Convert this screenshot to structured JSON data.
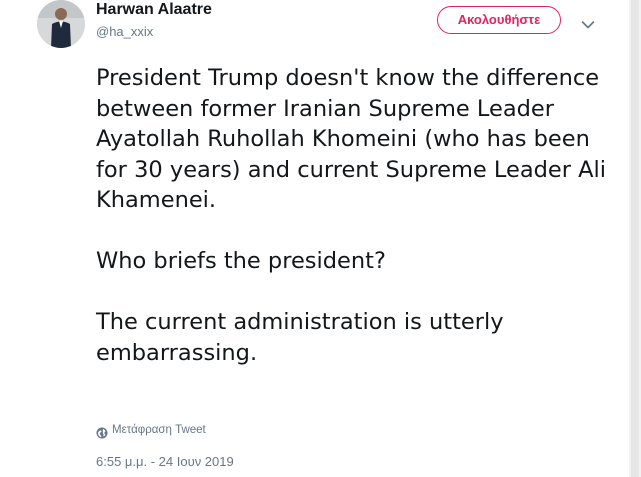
{
  "user": {
    "name": "Harwan Alaatre",
    "handle": "@ha_xxix"
  },
  "follow_button": {
    "label": "Ακολουθήστε"
  },
  "tweet": {
    "text": "President Trump doesn't know the difference between former Iranian Supreme Leader Ayatollah Ruhollah Khomeini (who has been for 30 years) and current Supreme Leader Ali Khamenei.\n\nWho briefs the president?\n\nThe current administration is utterly embarrassing.",
    "translate_label": "Μετάφραση Tweet",
    "timestamp": "6:55 μ.μ. - 24 Ιουν 2019"
  },
  "icons": {
    "menu": "chevron-down-icon",
    "translate": "globe-icon"
  },
  "colors": {
    "accent": "#e0245e",
    "text": "#14171a",
    "secondary": "#657786"
  }
}
